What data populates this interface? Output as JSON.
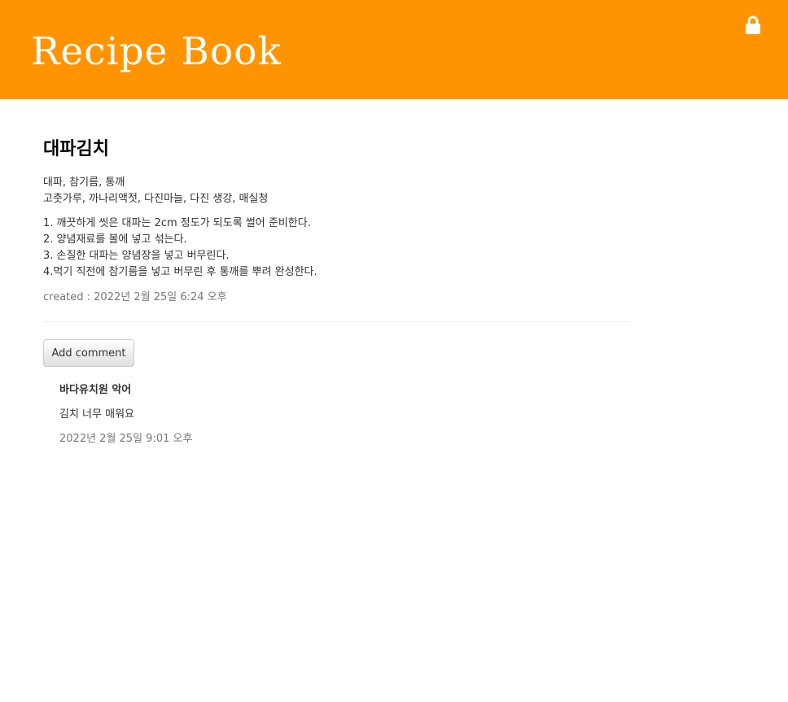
{
  "header": {
    "site_title": "Recipe Book",
    "lock_icon": "lock-icon",
    "background_color": "#ff9400"
  },
  "post": {
    "title": "대파김치",
    "ingredients": [
      "대파, 참기름, 통깨",
      "고춧가루, 까나리액젓, 다진마늘, 다진 생강, 매실청"
    ],
    "steps": [
      "1. 깨끗하게 씻은 대파는 2cm 정도가 되도록 썰어 준비한다.",
      "2. 양념재료를 볼에 넣고 섞는다.",
      "3. 손질한 대파는 양념장을 넣고 버무린다.",
      "4.먹기 직전에 참기름을 넣고 버무린 후 통깨를 뿌려 완성한다."
    ],
    "created": "created : 2022년 2월 25일 6:24 오후"
  },
  "actions": {
    "add_comment_label": "Add comment"
  },
  "comments": [
    {
      "author": "바다유치원 악어",
      "text": "김치 너무 매워요",
      "date": "2022년 2월 25일 9:01 오후"
    }
  ]
}
